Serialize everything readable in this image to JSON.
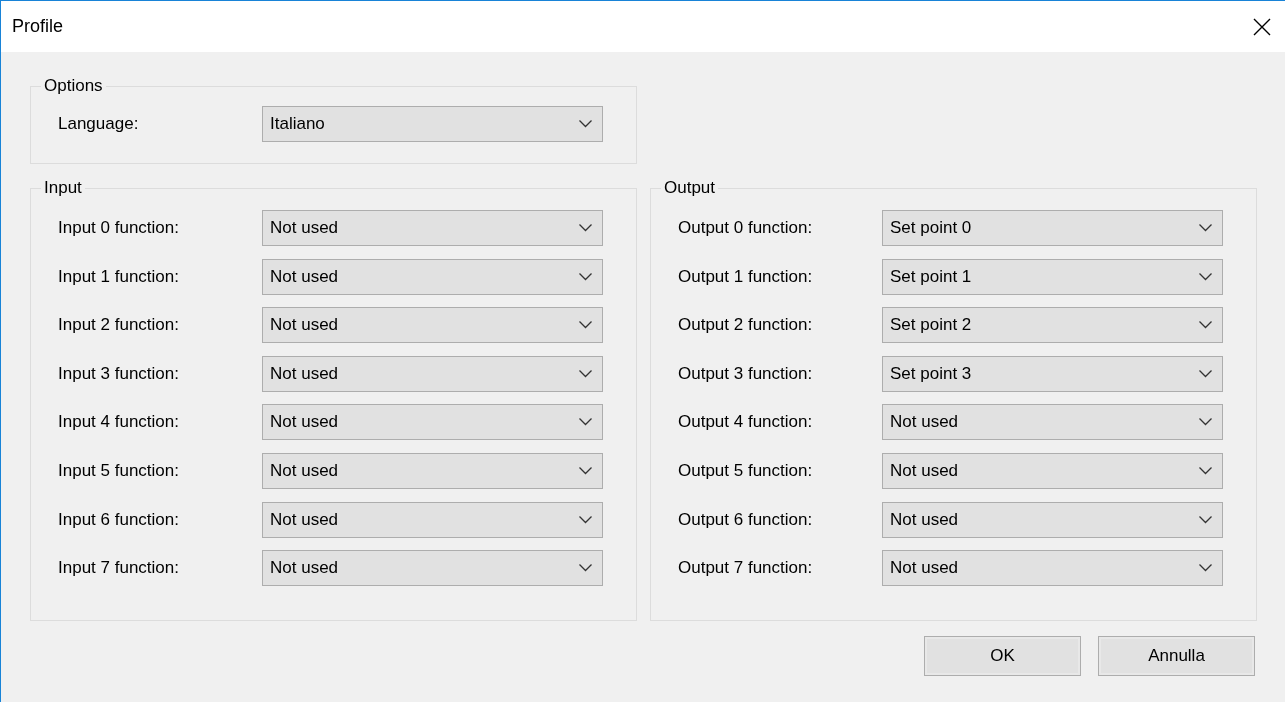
{
  "window": {
    "title": "Profile"
  },
  "options": {
    "title": "Options",
    "rows": [
      {
        "label": "Language:",
        "value": "Italiano"
      }
    ]
  },
  "groups": [
    {
      "title": "Input",
      "rows": [
        {
          "label": "Input 0 function:",
          "value": "Not used"
        },
        {
          "label": "Input 1 function:",
          "value": "Not used"
        },
        {
          "label": "Input 2 function:",
          "value": "Not used"
        },
        {
          "label": "Input 3 function:",
          "value": "Not used"
        },
        {
          "label": "Input 4 function:",
          "value": "Not used"
        },
        {
          "label": "Input 5 function:",
          "value": "Not used"
        },
        {
          "label": "Input 6 function:",
          "value": "Not used"
        },
        {
          "label": "Input 7 function:",
          "value": "Not used"
        }
      ]
    },
    {
      "title": "Output",
      "rows": [
        {
          "label": "Output 0 function:",
          "value": "Set point 0"
        },
        {
          "label": "Output 1 function:",
          "value": "Set point 1"
        },
        {
          "label": "Output 2 function:",
          "value": "Set point 2"
        },
        {
          "label": "Output 3 function:",
          "value": "Set point 3"
        },
        {
          "label": "Output 4 function:",
          "value": "Not used"
        },
        {
          "label": "Output 5 function:",
          "value": "Not used"
        },
        {
          "label": "Output 6 function:",
          "value": "Not used"
        },
        {
          "label": "Output 7 function:",
          "value": "Not used"
        }
      ]
    }
  ],
  "buttons": [
    "OK",
    "Annulla"
  ]
}
